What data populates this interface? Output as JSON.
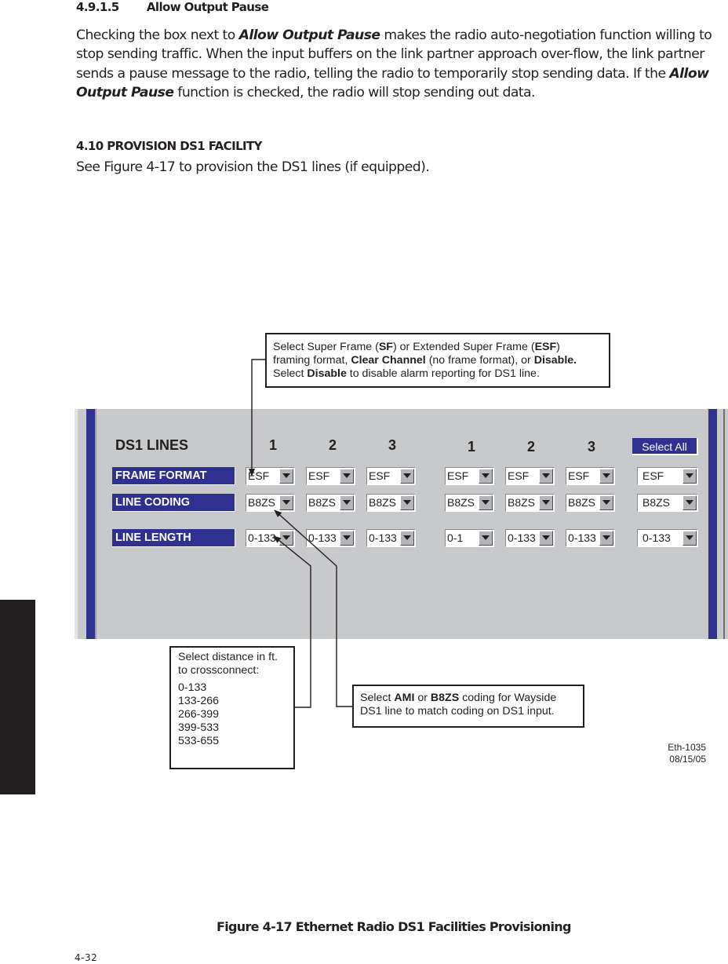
{
  "section_4_9_1_5": {
    "number": "4.9.1.5",
    "title": "Allow Output Pause",
    "paragraph": {
      "part1": "Checking the box next to ",
      "em1": "Allow Output Pause",
      "part2": " makes the radio auto-negotiation function willing to stop sending traffic. When the input buffers on the link partner approach over-flow, the link partner sends a pause message to the radio, telling the radio to temporarily stop sending data. If the ",
      "em2": "Allow Output Pause",
      "part3": " function is checked, the radio will stop sending out data."
    }
  },
  "section_4_10": {
    "heading": "4.10   PROVISION DS1 FACILITY",
    "paragraph": "See Figure 4-17 to provision the DS1 lines (if equipped)."
  },
  "figure": {
    "panel": {
      "title": "DS1 LINES",
      "column_numbers": [
        "1",
        "2",
        "3",
        "1",
        "2",
        "3"
      ],
      "select_all_label": "Select All",
      "rows": [
        {
          "label": "FRAME FORMAT",
          "values": [
            "ESF",
            "ESF",
            "ESF",
            "ESF",
            "ESF",
            "ESF",
            "ESF"
          ]
        },
        {
          "label": "LINE CODING",
          "values": [
            "B8ZS",
            "B8ZS",
            "B8ZS",
            "B8ZS",
            "B8ZS",
            "B8ZS",
            "B8ZS"
          ]
        },
        {
          "label": "LINE LENGTH",
          "values": [
            "0-133",
            "0-133",
            "0-133",
            "0-1",
            "0-133",
            "0-133",
            "0-133"
          ]
        }
      ]
    },
    "callouts": {
      "frame_format": {
        "t1": "Select Super Frame (",
        "b1": "SF",
        "t2": ") or Extended Super Frame (",
        "b2": "ESF",
        "t3": ")",
        "t4": "framing format, ",
        "b3": "Clear Channel",
        "t5": " (no frame format), or ",
        "b4": "Disable.",
        "t6": "Select ",
        "b5": "Disable",
        "t7": " to disable alarm reporting for DS1 line."
      },
      "line_length": {
        "line1": "Select distance in ft.",
        "line2": "to crossconnect:",
        "options": [
          "0-133",
          "133-266",
          "266-399",
          "399-533",
          "533-655"
        ]
      },
      "line_coding": {
        "t1": "Select ",
        "b1": "AMI",
        "t2": " or ",
        "b2": "B8ZS",
        "t3": " coding for Wayside",
        "t4": "DS1 line to match coding on DS1 input."
      }
    },
    "id": "Eth-1035",
    "date": "08/15/05",
    "caption": "Figure 4-17   Ethernet Radio DS1 Facilities Provisioning"
  },
  "page_number": "4-32",
  "colors": {
    "panel_gray": "#c8c9cb",
    "accent_navy": "#2e3190",
    "text": "#231f20"
  },
  "icons": {
    "dropdown": "triangle-down",
    "arrow": "arrowhead"
  }
}
